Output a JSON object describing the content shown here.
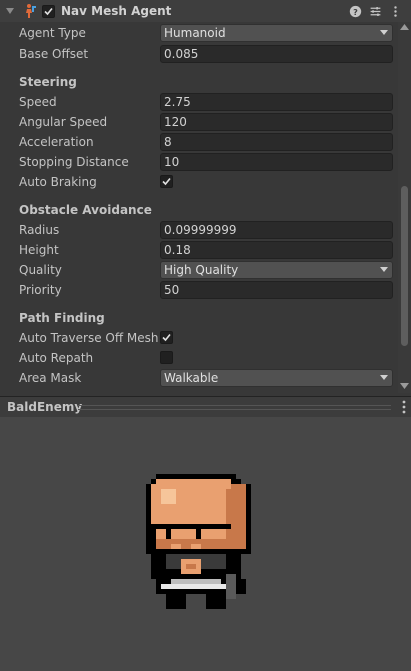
{
  "component": {
    "title": "Nav Mesh Agent",
    "enabled": true
  },
  "fields": {
    "agent_type": {
      "label": "Agent Type",
      "value": "Humanoid"
    },
    "base_offset": {
      "label": "Base Offset",
      "value": "0.085"
    }
  },
  "steering": {
    "title": "Steering",
    "speed": {
      "label": "Speed",
      "value": "2.75"
    },
    "angular_speed": {
      "label": "Angular Speed",
      "value": "120"
    },
    "acceleration": {
      "label": "Acceleration",
      "value": "8"
    },
    "stopping_distance": {
      "label": "Stopping Distance",
      "value": "10"
    },
    "auto_braking": {
      "label": "Auto Braking",
      "checked": true
    }
  },
  "obstacle": {
    "title": "Obstacle Avoidance",
    "radius": {
      "label": "Radius",
      "value": "0.09999999"
    },
    "height": {
      "label": "Height",
      "value": "0.18"
    },
    "quality": {
      "label": "Quality",
      "value": "High Quality"
    },
    "priority": {
      "label": "Priority",
      "value": "50"
    }
  },
  "path_finding": {
    "title": "Path Finding",
    "auto_traverse": {
      "label": "Auto Traverse Off Mesh Link",
      "checked": true
    },
    "auto_repath": {
      "label": "Auto Repath",
      "checked": false
    },
    "area_mask": {
      "label": "Area Mask",
      "value": "Walkable"
    }
  },
  "preview": {
    "title": "BaldEnemy"
  },
  "icons": {
    "component": "nav-mesh-agent-icon",
    "help": "help-icon",
    "presets": "presets-icon",
    "menu": "kebab-menu-icon"
  }
}
